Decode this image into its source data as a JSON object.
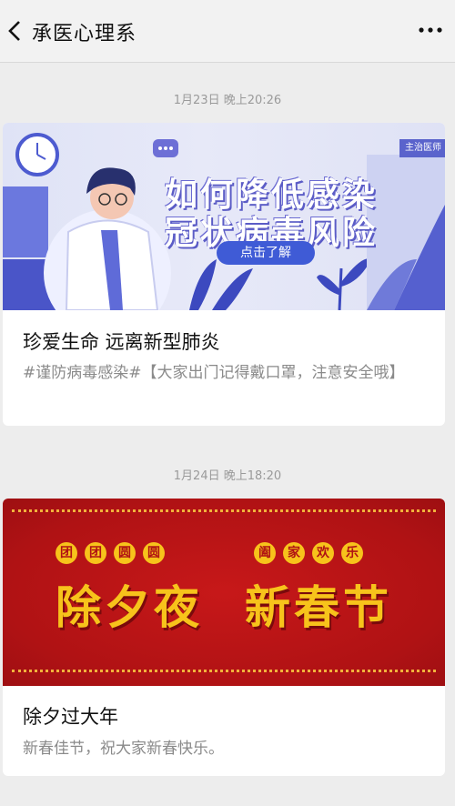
{
  "header": {
    "title": "承医心理系"
  },
  "messages": [
    {
      "timestamp": "1月23日 晚上20:26",
      "banner": {
        "headline_1": "如何降低感染",
        "headline_2": "冠状病毒风险",
        "button": "点击了解",
        "tag": "主治医师"
      },
      "title": "珍爱生命 远离新型肺炎",
      "description": "#谨防病毒感染#【大家出门记得戴口罩，注意安全哦】"
    },
    {
      "timestamp": "1月24日 晚上18:20",
      "banner": {
        "badges_left": [
          "团",
          "团",
          "圆",
          "圆"
        ],
        "badges_right": [
          "阖",
          "家",
          "欢",
          "乐"
        ],
        "big_left": "除夕夜",
        "big_right": "新春节"
      },
      "title": "除夕过大年",
      "description": "新春佳节，祝大家新春快乐。"
    }
  ],
  "colors": {
    "accent_blue": "#3f5bd6",
    "festive_red": "#b01214",
    "gold": "#f7c31b"
  }
}
